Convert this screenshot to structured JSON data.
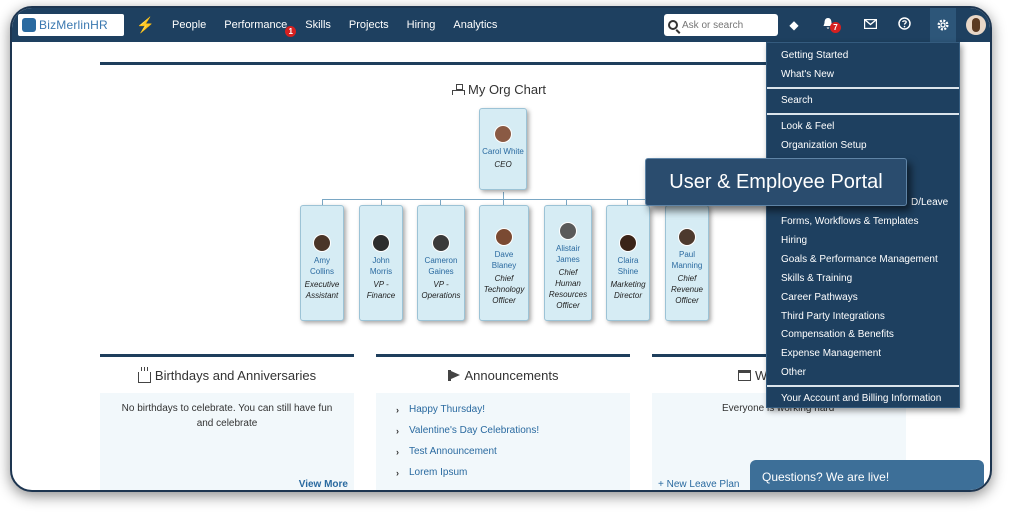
{
  "app": {
    "logo_text": "BizMerlinHR"
  },
  "nav": {
    "items": [
      "People",
      "Performance",
      "Skills",
      "Projects",
      "Hiring",
      "Analytics"
    ],
    "performance_badge": "1",
    "search_placeholder": "Ask or search",
    "notifications_badge": "7"
  },
  "org_chart": {
    "title": "My Org Chart",
    "ceo": {
      "name": "Carol White",
      "role": "CEO"
    },
    "reports": [
      {
        "name": "Amy Collins",
        "role": "Executive Assistant"
      },
      {
        "name": "John Morris",
        "role": "VP - Finance"
      },
      {
        "name": "Cameron Gaines",
        "role": "VP - Operations"
      },
      {
        "name": "Dave Blaney",
        "role": "Chief Technology Officer"
      },
      {
        "name": "Alistair James",
        "role": "Chief Human Resources Officer"
      },
      {
        "name": "Claira Shine",
        "role": "Marketing Director"
      },
      {
        "name": "Paul Manning",
        "role": "Chief Revenue Officer"
      }
    ]
  },
  "birthdays": {
    "title": "Birthdays and Anniversaries",
    "message": "No birthdays to celebrate. You can still have fun and celebrate",
    "view_more": "View More"
  },
  "announcements": {
    "title": "Announcements",
    "items": [
      "Happy Thursday!",
      "Valentine's Day Celebrations!",
      "Test Announcement",
      "Lorem Ipsum"
    ]
  },
  "leave": {
    "title": "W",
    "message": "Everyone is working hard",
    "new_leave": "+ New Leave Plan"
  },
  "settings_menu": {
    "items": [
      "Getting Started",
      "What's New",
      "Search",
      "Look & Feel",
      "Organization Setup",
      "D/Leave",
      "Forms, Workflows & Templates",
      "Hiring",
      "Goals & Performance Management",
      "Skills & Training",
      "Career Pathways",
      "Third Party Integrations",
      "Compensation & Benefits",
      "Expense Management",
      "Other",
      "Your Account and Billing Information"
    ]
  },
  "callout": {
    "text": "User & Employee Portal"
  },
  "chat": {
    "text": "Questions? We are live!"
  }
}
